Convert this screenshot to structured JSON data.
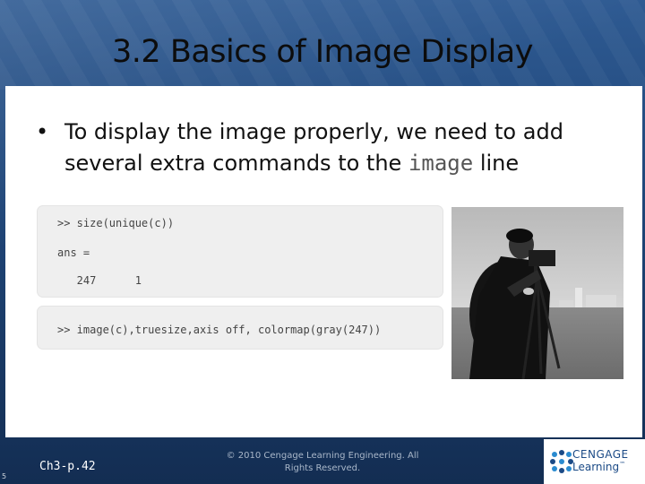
{
  "slide": {
    "title": "3.2 Basics of Image Display",
    "bullet": {
      "symbol": "•",
      "text_before": "To display the image properly, we need to add several extra commands to the ",
      "code_word": "image",
      "text_after": " line"
    },
    "code_box_1": {
      "line1": ">> size(unique(c))",
      "line2": "ans =",
      "line3": "   247      1"
    },
    "code_box_2": {
      "line1": ">> image(c),truesize,axis off, colormap(gray(247))"
    },
    "photo": {
      "subject": "cameraman-photo"
    }
  },
  "footer": {
    "chapter_ref": "Ch3-p.42",
    "copyright_line1": "© 2010 Cengage Learning Engineering. All",
    "copyright_line2": "Rights Reserved.",
    "page_number": "5",
    "logo_line1": "CENGAGE",
    "logo_line2": "Learning",
    "logo_tm": "™"
  },
  "colors": {
    "background": "#1f4577",
    "panel": "#ffffff",
    "code_bg": "#efefef",
    "logo_blue": "#1b4a86"
  }
}
